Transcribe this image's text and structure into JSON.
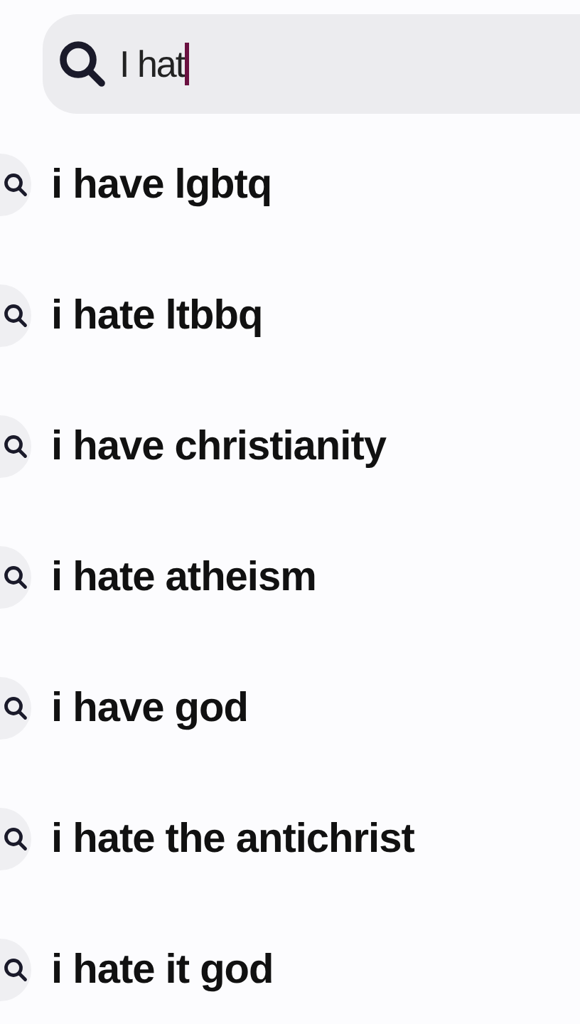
{
  "search": {
    "value": "I hat",
    "focused": true
  },
  "suggestions": [
    {
      "text": "i have lgbtq"
    },
    {
      "text": "i hate ltbbq"
    },
    {
      "text": "i have christianity"
    },
    {
      "text": "i hate atheism"
    },
    {
      "text": "i have god"
    },
    {
      "text": "i hate the antichrist"
    },
    {
      "text": "i hate it god"
    }
  ]
}
